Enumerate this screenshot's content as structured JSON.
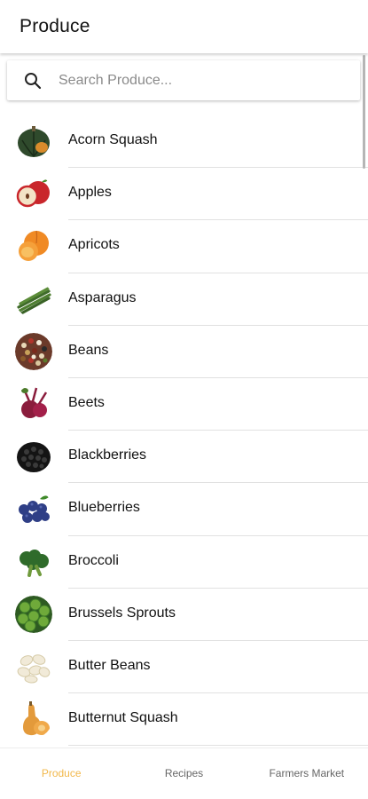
{
  "header": {
    "title": "Produce"
  },
  "search": {
    "placeholder": "Search Produce...",
    "value": ""
  },
  "list": {
    "items": [
      {
        "label": "Acorn Squash",
        "icon": "acorn-squash-image"
      },
      {
        "label": "Apples",
        "icon": "apples-image"
      },
      {
        "label": "Apricots",
        "icon": "apricots-image"
      },
      {
        "label": "Asparagus",
        "icon": "asparagus-image"
      },
      {
        "label": "Beans",
        "icon": "beans-image"
      },
      {
        "label": "Beets",
        "icon": "beets-image"
      },
      {
        "label": "Blackberries",
        "icon": "blackberries-image"
      },
      {
        "label": "Blueberries",
        "icon": "blueberries-image"
      },
      {
        "label": "Broccoli",
        "icon": "broccoli-image"
      },
      {
        "label": "Brussels Sprouts",
        "icon": "brussels-sprouts-image"
      },
      {
        "label": "Butter Beans",
        "icon": "butter-beans-image"
      },
      {
        "label": "Butternut Squash",
        "icon": "butternut-squash-image"
      }
    ]
  },
  "bottom_nav": {
    "tabs": [
      {
        "label": "Produce",
        "active": true
      },
      {
        "label": "Recipes",
        "active": false
      },
      {
        "label": "Farmers Market",
        "active": false
      }
    ]
  },
  "colors": {
    "accent": "#f2b84b",
    "divider": "#e1e1e1",
    "text": "#111111"
  }
}
